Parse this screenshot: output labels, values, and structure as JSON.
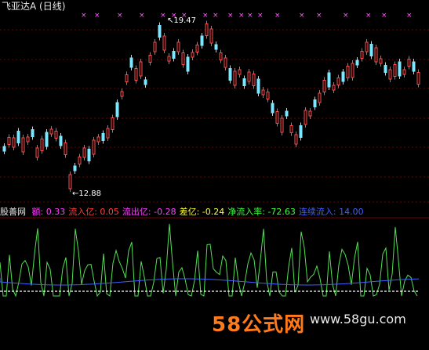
{
  "app": {
    "title": "飞亚达A (日线)"
  },
  "price_panel": {
    "high_label": "19.47",
    "low_label": "12.88",
    "colors": {
      "up": "#ff4d4d",
      "down": "#7fe6ff",
      "x_marker": "#ff5cff",
      "grid": "#6a0000"
    }
  },
  "indicator": {
    "name": "股善网",
    "fields": [
      {
        "label": "额:",
        "value": "0.33",
        "color": "#ff40ff"
      },
      {
        "label": "流入亿:",
        "value": "0.05",
        "color": "#ff4040"
      },
      {
        "label": "流出亿:",
        "value": "-0.28",
        "color": "#ff40ff"
      },
      {
        "label": "差亿:",
        "value": "-0.24",
        "color": "#ffff40"
      },
      {
        "label": "净流入率:",
        "value": "-72.63",
        "color": "#40ff40"
      },
      {
        "label": "连续流入:",
        "value": "14.00",
        "color": "#4060ff"
      }
    ]
  },
  "watermark": {
    "brand": "58公式网",
    "url": "www.58gu.com"
  }
}
